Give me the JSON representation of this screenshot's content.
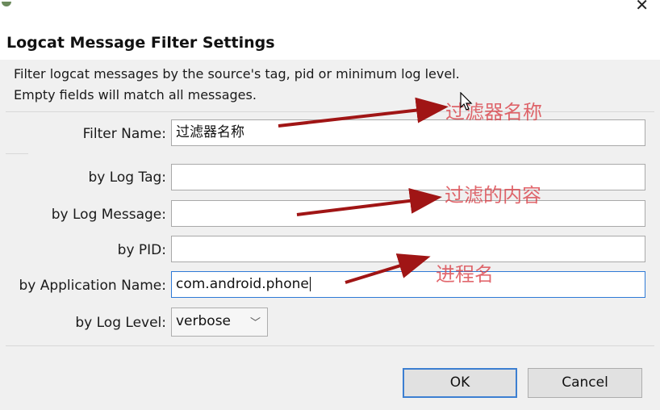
{
  "window": {
    "title": "Logcat Message Filter Settings",
    "close_glyph": "✕"
  },
  "description": {
    "line1": "Filter logcat messages by the source's tag, pid or minimum log level.",
    "line2": "Empty fields will match all messages."
  },
  "form": {
    "filter_name": {
      "label": "Filter Name:",
      "value": "过滤器名称"
    },
    "log_tag": {
      "label": "by Log Tag:",
      "value": ""
    },
    "log_message": {
      "label": "by Log Message:",
      "value": ""
    },
    "pid": {
      "label": "by PID:",
      "value": ""
    },
    "application_name": {
      "label": "by Application Name:",
      "value": "com.android.phone"
    },
    "log_level": {
      "label": "by Log Level:",
      "value": "verbose"
    }
  },
  "buttons": {
    "ok": "OK",
    "cancel": "Cancel"
  },
  "annotations": {
    "filter_name_note": "过滤器名称",
    "content_note": "过滤的内容",
    "process_note": "进程名"
  },
  "colors": {
    "annotation": "#d9363e",
    "arrow": "#a01515",
    "focus_border": "#2f7ad6"
  }
}
